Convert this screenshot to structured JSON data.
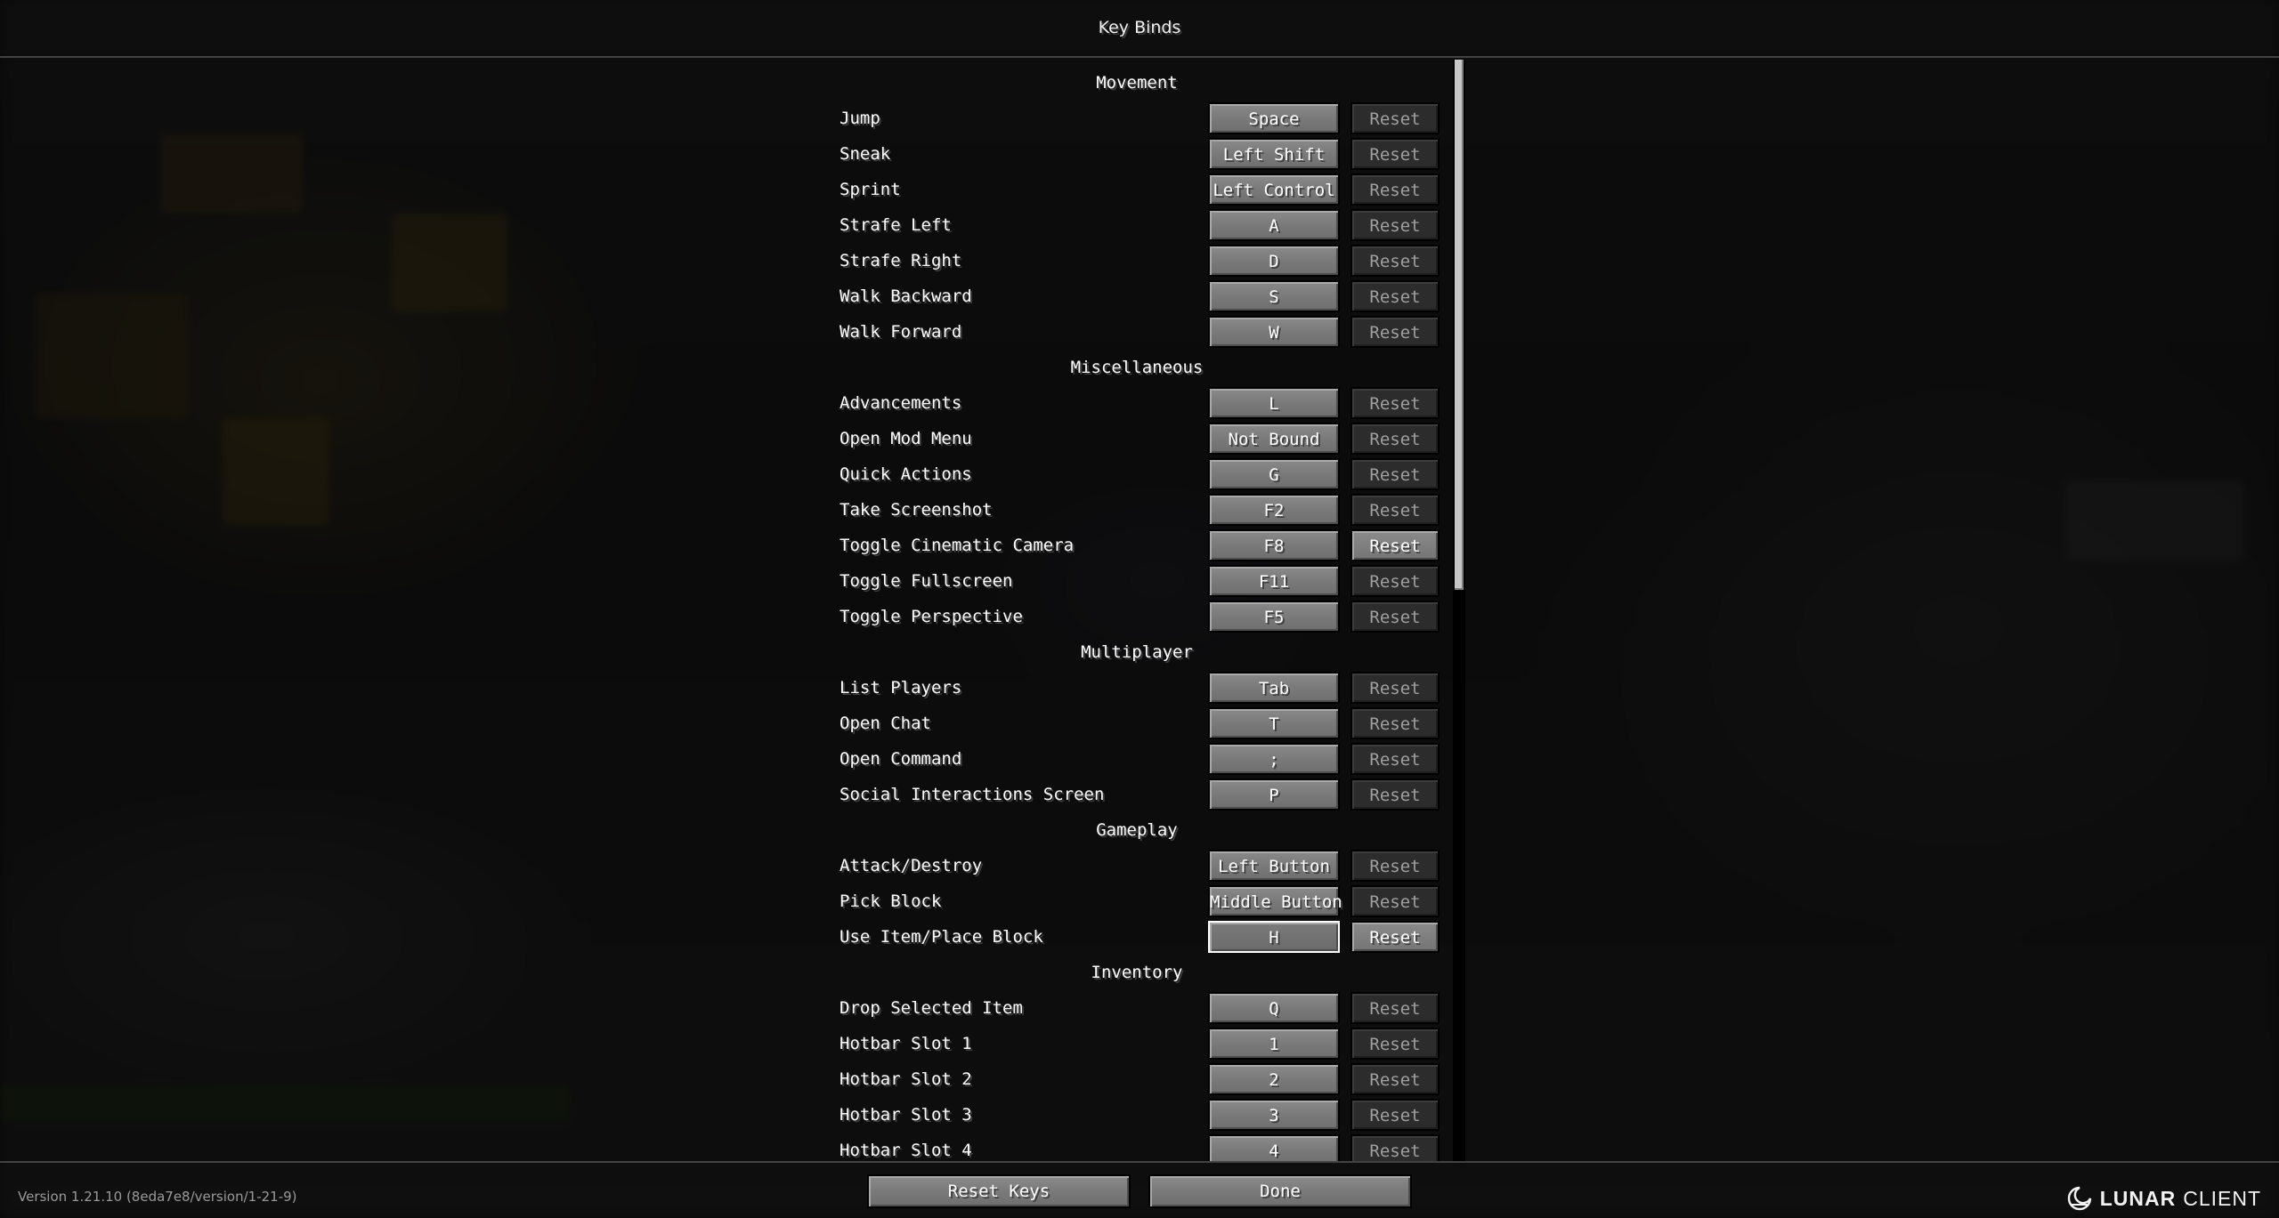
{
  "window": {
    "title": "Key Binds"
  },
  "categories": [
    {
      "name": "Movement",
      "bindings": [
        {
          "action": "Jump",
          "key": "Space",
          "reset": "Reset",
          "reset_enabled": false
        },
        {
          "action": "Sneak",
          "key": "Left Shift",
          "reset": "Reset",
          "reset_enabled": false
        },
        {
          "action": "Sprint",
          "key": "Left Control",
          "reset": "Reset",
          "reset_enabled": false
        },
        {
          "action": "Strafe Left",
          "key": "A",
          "reset": "Reset",
          "reset_enabled": false
        },
        {
          "action": "Strafe Right",
          "key": "D",
          "reset": "Reset",
          "reset_enabled": false
        },
        {
          "action": "Walk Backward",
          "key": "S",
          "reset": "Reset",
          "reset_enabled": false
        },
        {
          "action": "Walk Forward",
          "key": "W",
          "reset": "Reset",
          "reset_enabled": false
        }
      ]
    },
    {
      "name": "Miscellaneous",
      "bindings": [
        {
          "action": "Advancements",
          "key": "L",
          "reset": "Reset",
          "reset_enabled": false
        },
        {
          "action": "Open Mod Menu",
          "key": "Not Bound",
          "reset": "Reset",
          "reset_enabled": false
        },
        {
          "action": "Quick Actions",
          "key": "G",
          "reset": "Reset",
          "reset_enabled": false
        },
        {
          "action": "Take Screenshot",
          "key": "F2",
          "reset": "Reset",
          "reset_enabled": false
        },
        {
          "action": "Toggle Cinematic Camera",
          "key": "F8",
          "reset": "Reset",
          "reset_enabled": true
        },
        {
          "action": "Toggle Fullscreen",
          "key": "F11",
          "reset": "Reset",
          "reset_enabled": false
        },
        {
          "action": "Toggle Perspective",
          "key": "F5",
          "reset": "Reset",
          "reset_enabled": false
        }
      ]
    },
    {
      "name": "Multiplayer",
      "bindings": [
        {
          "action": "List Players",
          "key": "Tab",
          "reset": "Reset",
          "reset_enabled": false
        },
        {
          "action": "Open Chat",
          "key": "T",
          "reset": "Reset",
          "reset_enabled": false
        },
        {
          "action": "Open Command",
          "key": ";",
          "reset": "Reset",
          "reset_enabled": false
        },
        {
          "action": "Social Interactions Screen",
          "key": "P",
          "reset": "Reset",
          "reset_enabled": false
        }
      ]
    },
    {
      "name": "Gameplay",
      "bindings": [
        {
          "action": "Attack/Destroy",
          "key": "Left Button",
          "reset": "Reset",
          "reset_enabled": false
        },
        {
          "action": "Pick Block",
          "key": "Middle Button",
          "reset": "Reset",
          "reset_enabled": false
        },
        {
          "action": "Use Item/Place Block",
          "key": "H",
          "reset": "Reset",
          "reset_enabled": true,
          "selected": true
        }
      ]
    },
    {
      "name": "Inventory",
      "bindings": [
        {
          "action": "Drop Selected Item",
          "key": "Q",
          "reset": "Reset",
          "reset_enabled": false
        },
        {
          "action": "Hotbar Slot 1",
          "key": "1",
          "reset": "Reset",
          "reset_enabled": false
        },
        {
          "action": "Hotbar Slot 2",
          "key": "2",
          "reset": "Reset",
          "reset_enabled": false
        },
        {
          "action": "Hotbar Slot 3",
          "key": "3",
          "reset": "Reset",
          "reset_enabled": false
        },
        {
          "action": "Hotbar Slot 4",
          "key": "4",
          "reset": "Reset",
          "reset_enabled": false
        }
      ]
    }
  ],
  "footer": {
    "reset_keys_label": "Reset Keys",
    "done_label": "Done",
    "version": "Version 1.21.10 (8eda7e8/version/1-21-9)",
    "brand_bold": "LUNAR",
    "brand_light": "CLIENT"
  },
  "icons": {
    "brand_logo": "lunar-client-logo-icon"
  }
}
